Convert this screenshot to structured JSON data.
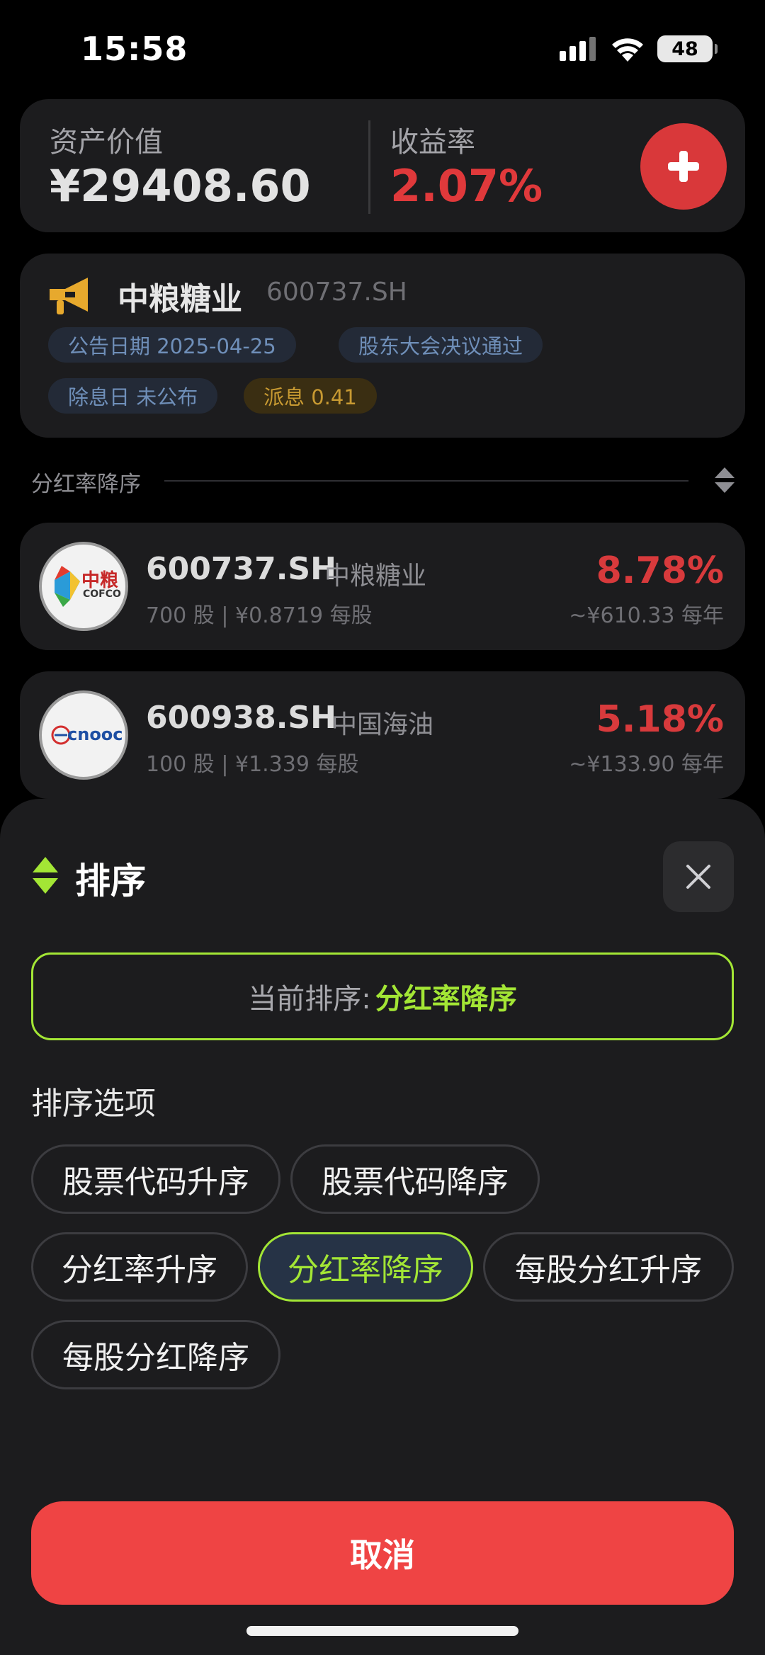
{
  "status": {
    "time": "15:58",
    "battery": "48"
  },
  "summary": {
    "asset_label": "资产价值",
    "asset_value": "¥29408.60",
    "rate_label": "收益率",
    "rate_value": "2.07%"
  },
  "notice": {
    "name": "中粮糖业",
    "code": "600737.SH",
    "chips": {
      "date": "公告日期 2025-04-25",
      "resolution": "股东大会决议通过",
      "ex_date": "除息日 未公布",
      "dividend": "派息 0.41"
    }
  },
  "sort_bar": {
    "label": "分红率降序"
  },
  "stocks": [
    {
      "code": "600737.SH",
      "name": "中粮糖业",
      "detail": "700 股 | ¥0.8719 每股",
      "rate": "8.78%",
      "annual": "~¥610.33 每年",
      "logo_text": "中粮",
      "logo_sub": "COFCO"
    },
    {
      "code": "600938.SH",
      "name": "中国海油",
      "detail": "100 股 | ¥1.339 每股",
      "rate": "5.18%",
      "annual": "~¥133.90 每年",
      "logo_text": "cnooc"
    }
  ],
  "sheet": {
    "title": "排序",
    "current_label": "当前排序:",
    "current_value": "分红率降序",
    "options_heading": "排序选项",
    "options": [
      "股票代码升序",
      "股票代码降序",
      "分红率升序",
      "分红率降序",
      "每股分红升序",
      "每股分红降序"
    ],
    "selected": "分红率降序",
    "cancel": "取消"
  },
  "colors": {
    "accent": "#a3e635",
    "red": "#ef4444",
    "negative": "#d83a3c"
  }
}
